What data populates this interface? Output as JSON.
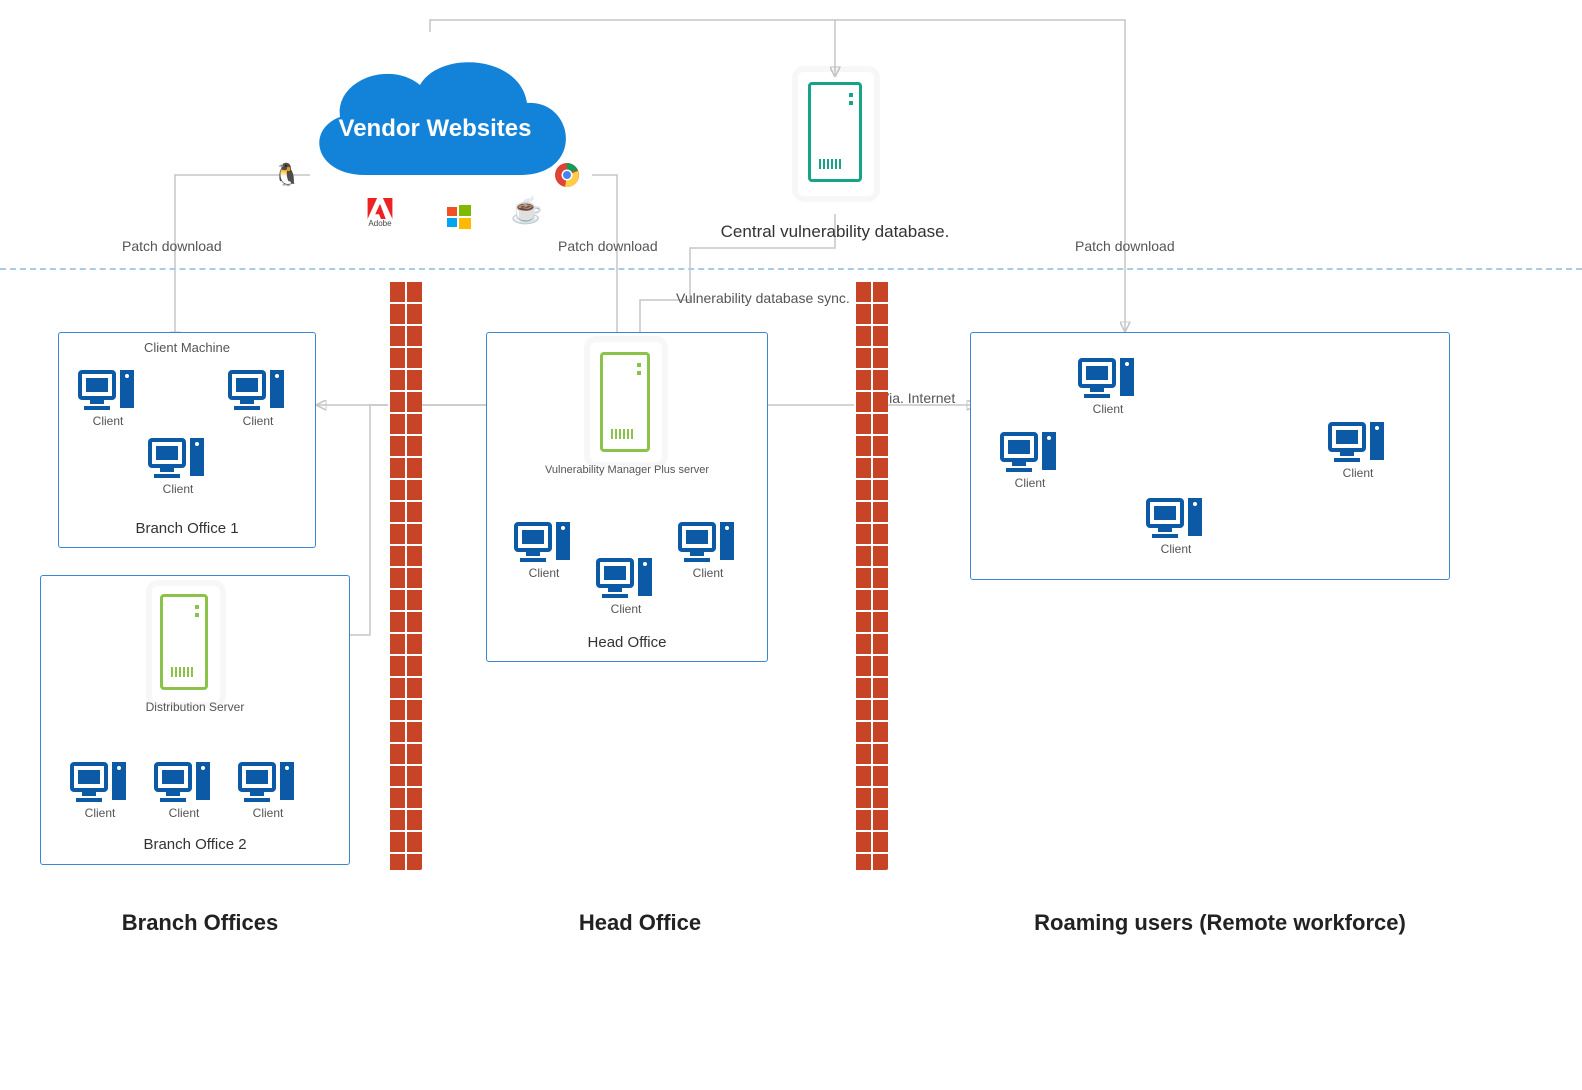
{
  "cloud": {
    "label": "Vendor Websites"
  },
  "central_db": {
    "label": "Central vulnerability database."
  },
  "edges": {
    "patch_download_left": "Patch download",
    "patch_download_mid": "Patch download",
    "patch_download_right": "Patch download",
    "vuln_sync": "Vulnerability database sync.",
    "via_internet": "Via. Internet"
  },
  "branch1": {
    "title": "Branch Office 1",
    "header": "Client Machine",
    "client_label": "Client"
  },
  "branch2": {
    "title": "Branch Office 2",
    "dist_server": "Distribution Server",
    "client_label": "Client"
  },
  "head_office": {
    "server_label": "Vulnerability Manager Plus server",
    "title": "Head Office",
    "client_label": "Client"
  },
  "roaming": {
    "client_label": "Client"
  },
  "sections": {
    "branch": "Branch Offices",
    "head": "Head Office",
    "roaming": "Roaming users (Remote workforce)"
  },
  "vendor_logos": {
    "linux": "linux-icon",
    "apple": "apple-icon",
    "adobe": "adobe-icon",
    "adobe_text": "Adobe",
    "windows": "windows-icon",
    "java": "java-icon",
    "chrome": "chrome-icon"
  },
  "colors": {
    "blue": "#1283d8",
    "navy": "#0c5aa6",
    "green": "#17a38a",
    "lime": "#8bc34a",
    "firewall": "#c74427",
    "border": "#3a86d0"
  }
}
